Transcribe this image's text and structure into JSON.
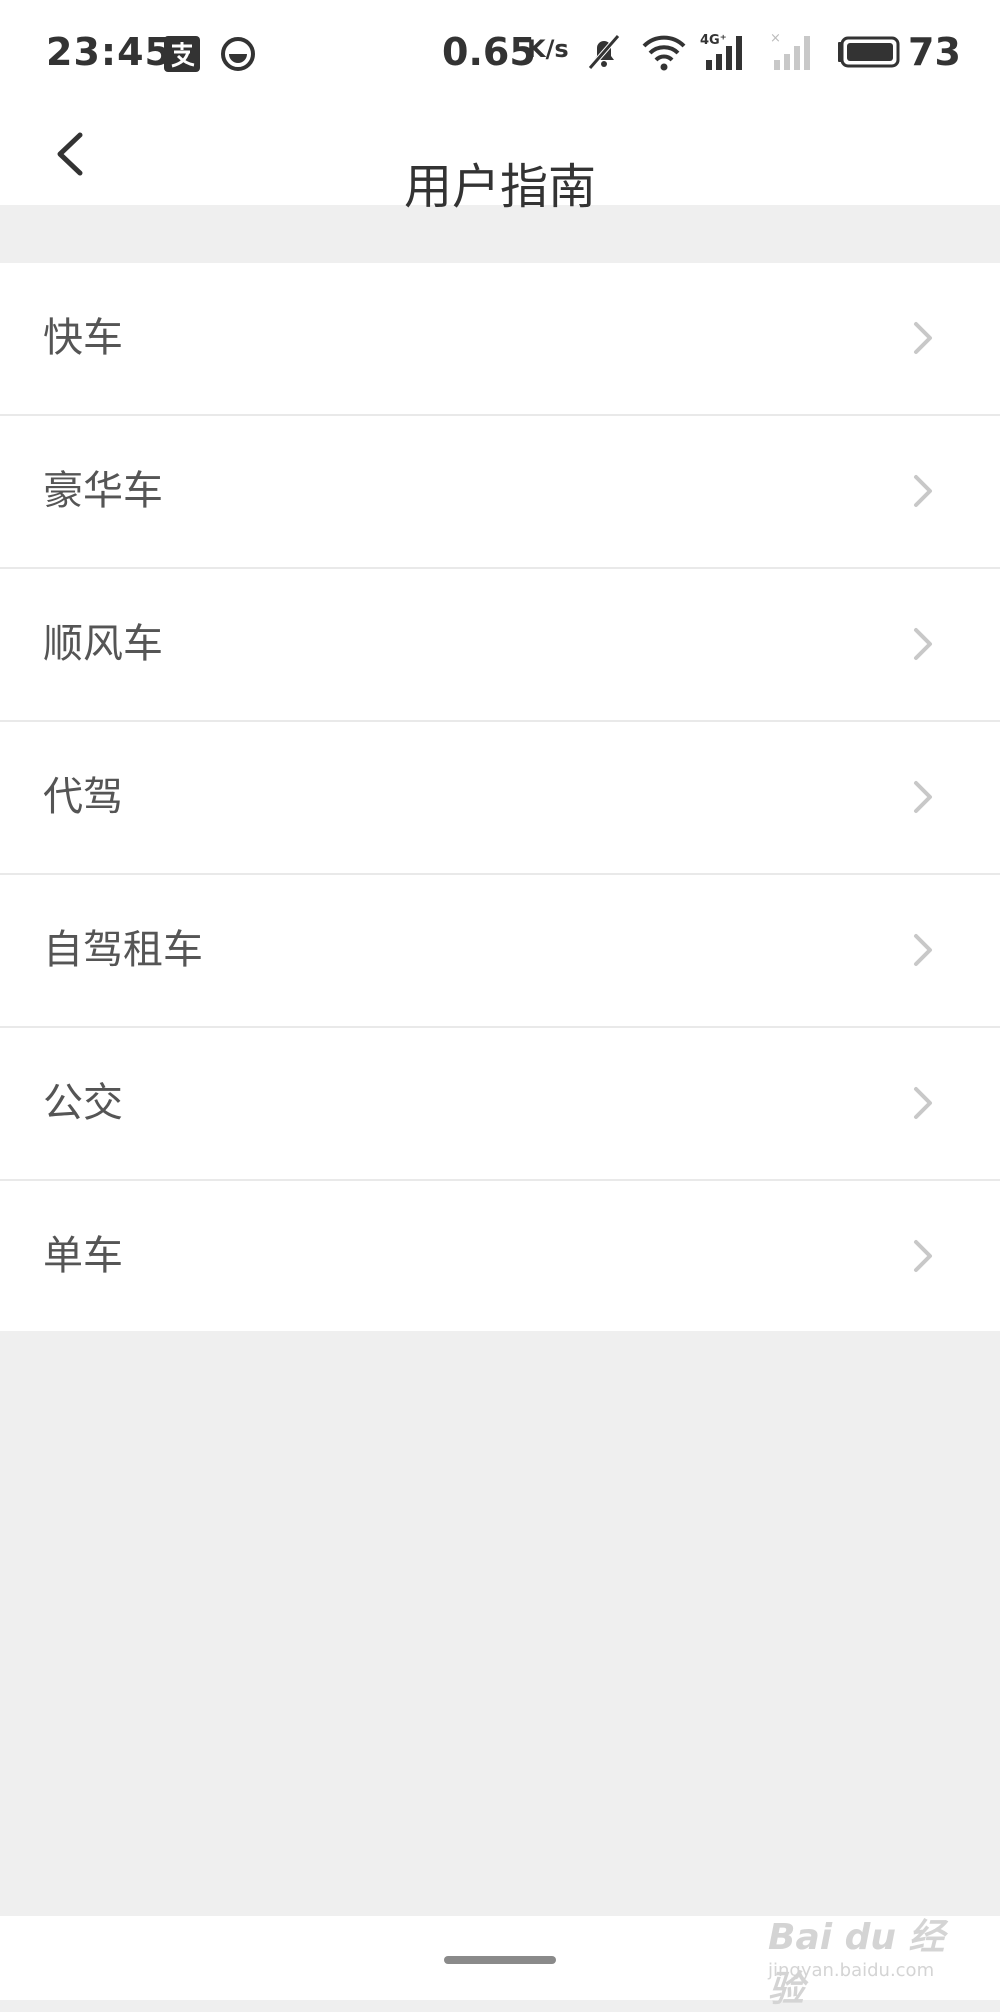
{
  "status_bar": {
    "time": "23:45",
    "network_speed": "0.65",
    "network_speed_unit": "K/s",
    "battery_percent": "73",
    "icons": [
      "alipay-icon",
      "app-circle-icon",
      "mute-bell-icon",
      "wifi-icon",
      "signal-4g-icon",
      "signal-nosim-icon",
      "battery-icon"
    ]
  },
  "header": {
    "title": "用户指南",
    "back_icon": "chevron-left-icon"
  },
  "list": {
    "items": [
      {
        "label": "快车"
      },
      {
        "label": "豪华车"
      },
      {
        "label": "顺风车"
      },
      {
        "label": "代驾"
      },
      {
        "label": "自驾租车"
      },
      {
        "label": "公交"
      },
      {
        "label": "单车"
      }
    ],
    "chevron_icon": "chevron-right-icon"
  },
  "watermark": {
    "text": "Bai du 经验",
    "url": "jingyan.baidu.com"
  },
  "colors": {
    "background": "#efefef",
    "surface": "#ffffff",
    "text_primary": "#333333",
    "text_item": "#555555",
    "chevron": "#c8c8c8",
    "divider": "#e9e9e9"
  }
}
